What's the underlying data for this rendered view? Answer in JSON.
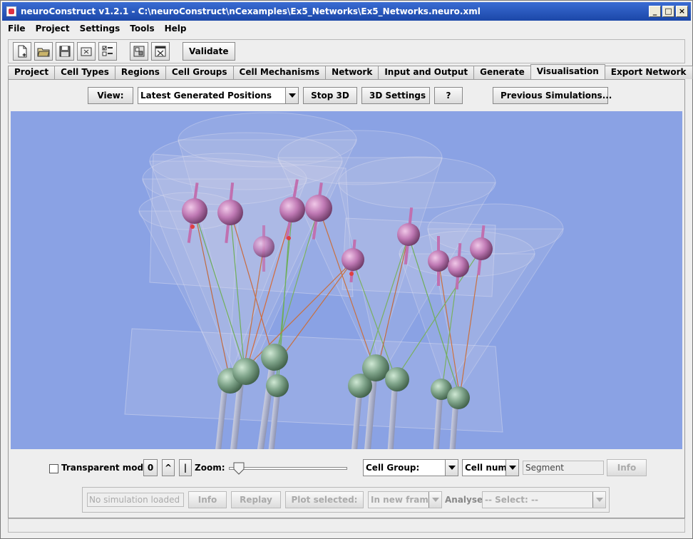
{
  "window": {
    "title": "neuroConstruct v1.2.1 - C:\\neuroConstruct\\nCexamples\\Ex5_Networks\\Ex5_Networks.neuro.xml",
    "controls": [
      "_",
      "□",
      "×"
    ]
  },
  "menu": [
    "File",
    "Project",
    "Settings",
    "Tools",
    "Help"
  ],
  "toolbar": {
    "icons": [
      "new-project-icon",
      "open-project-icon",
      "save-icon",
      "close-project-icon",
      "options-icon",
      "preferences-icon",
      "exit-icon"
    ],
    "validate_label": "Validate"
  },
  "tabs": [
    "Project",
    "Cell Types",
    "Regions",
    "Cell Groups",
    "Cell Mechanisms",
    "Network",
    "Input and Output",
    "Generate",
    "Visualisation",
    "Export Network"
  ],
  "active_tab": "Visualisation",
  "viewbar": {
    "view_label": "View:",
    "view_selected": "Latest Generated Positions",
    "stop3d_label": "Stop 3D",
    "settings3d_label": "3D Settings",
    "help_label": "?",
    "prev_sims_label": "Previous Simulations..."
  },
  "controls": {
    "transparent_label": "Transparent mode",
    "transparent_checked": false,
    "btn_zero": "0",
    "btn_up": "^",
    "btn_bar": "|",
    "zoom_label": "Zoom:",
    "zoom_value": 0.04,
    "cell_group_label": "Cell Group:",
    "cell_num_label": "Cell num:",
    "segment_value": "Segment",
    "info_label": "Info"
  },
  "sim_controls": {
    "sim_status": "No simulation loaded",
    "info_label": "Info",
    "replay_label": "Replay",
    "plot_label": "Plot selected:",
    "frame_option": "In new frame",
    "analyse_label": "Analyse:",
    "analyse_option": "-- Select: --"
  },
  "colors": {
    "scene_background": "#8aa2e4",
    "upper_cells": "#c07ab5",
    "lower_cells": "#7fa48a"
  }
}
